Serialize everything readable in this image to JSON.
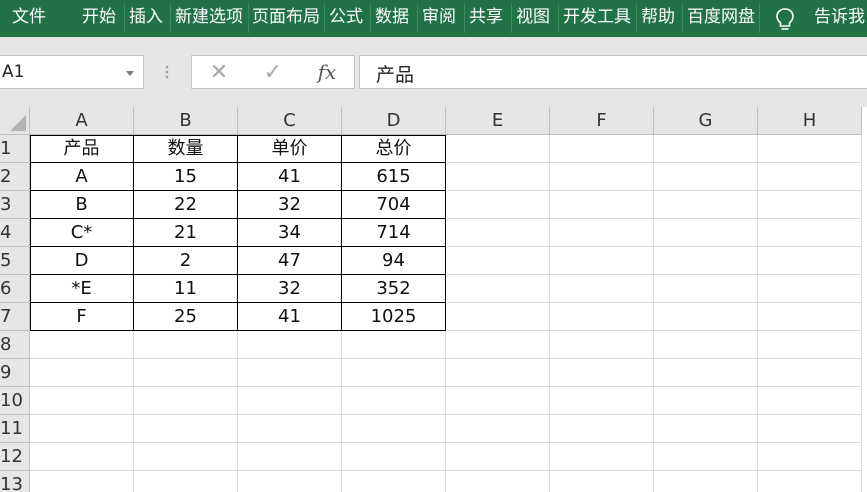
{
  "ribbon": {
    "tabs": [
      "文件",
      "开始",
      "插入",
      "新建选项",
      "页面布局",
      "公式",
      "数据",
      "审阅",
      "共享",
      "视图",
      "开发工具",
      "帮助",
      "百度网盘"
    ],
    "tell_me": "告诉我"
  },
  "formula_bar": {
    "name_box": "A1",
    "cancel_symbol": "✕",
    "enter_symbol": "✓",
    "fx_label": "fx",
    "content": "产品"
  },
  "sheet": {
    "columns": [
      "A",
      "B",
      "C",
      "D",
      "E",
      "F",
      "G",
      "H"
    ],
    "rows": [
      "1",
      "2",
      "3",
      "4",
      "5",
      "6",
      "7",
      "8",
      "9",
      "10",
      "11",
      "12",
      "13"
    ],
    "table": [
      [
        "产品",
        "数量",
        "单价",
        "总价"
      ],
      [
        "A",
        "15",
        "41",
        "615"
      ],
      [
        "B",
        "22",
        "32",
        "704"
      ],
      [
        "C*",
        "21",
        "34",
        "714"
      ],
      [
        "D",
        "2",
        "47",
        "94"
      ],
      [
        "*E",
        "11",
        "32",
        "352"
      ],
      [
        "F",
        "25",
        "41",
        "1025"
      ]
    ]
  },
  "colors": {
    "ribbon_bg": "#217346",
    "header_bg": "#e6e6e6"
  }
}
